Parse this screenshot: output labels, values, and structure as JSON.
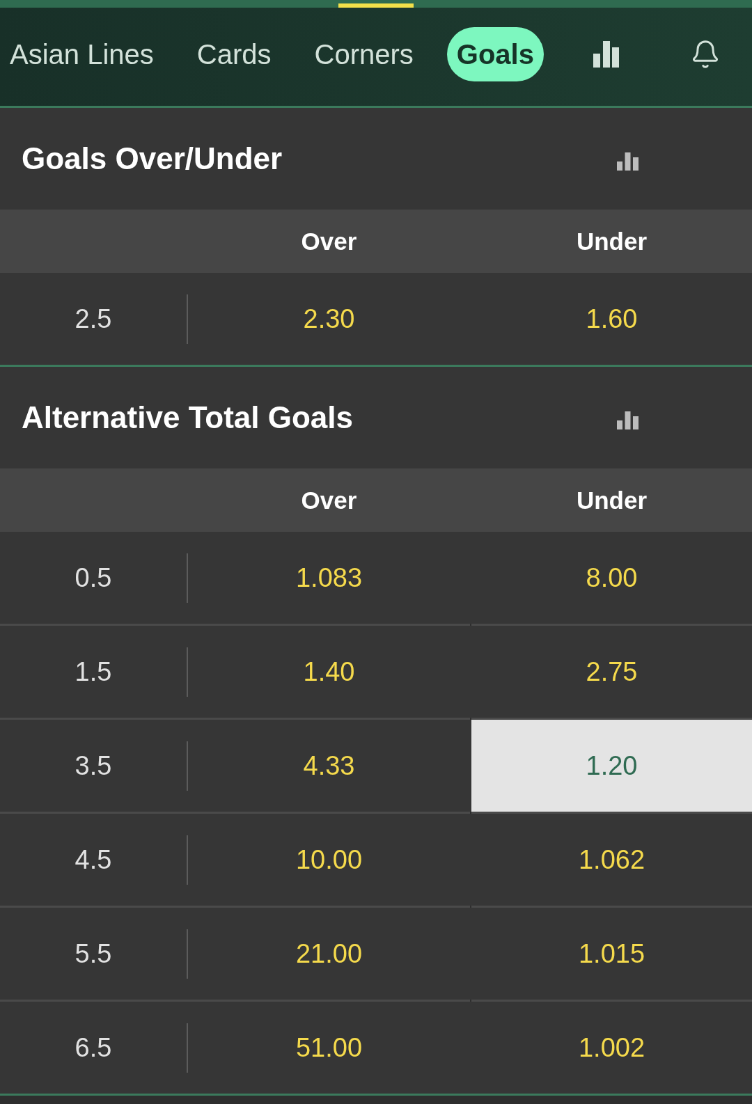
{
  "nav": {
    "tabs": [
      {
        "label": "Asian Lines",
        "selected": false
      },
      {
        "label": "Cards",
        "selected": false
      },
      {
        "label": "Corners",
        "selected": false
      },
      {
        "label": "Goals",
        "selected": true
      }
    ]
  },
  "markets": [
    {
      "title": "Goals Over/Under",
      "columns": [
        "Over",
        "Under"
      ],
      "rows": [
        {
          "line": "2.5",
          "odds": [
            {
              "value": "2.30",
              "selected": false
            },
            {
              "value": "1.60",
              "selected": false
            }
          ]
        }
      ]
    },
    {
      "title": "Alternative Total Goals",
      "columns": [
        "Over",
        "Under"
      ],
      "rows": [
        {
          "line": "0.5",
          "odds": [
            {
              "value": "1.083",
              "selected": false
            },
            {
              "value": "8.00",
              "selected": false
            }
          ]
        },
        {
          "line": "1.5",
          "odds": [
            {
              "value": "1.40",
              "selected": false
            },
            {
              "value": "2.75",
              "selected": false
            }
          ]
        },
        {
          "line": "3.5",
          "odds": [
            {
              "value": "4.33",
              "selected": false
            },
            {
              "value": "1.20",
              "selected": true
            }
          ]
        },
        {
          "line": "4.5",
          "odds": [
            {
              "value": "10.00",
              "selected": false
            },
            {
              "value": "1.062",
              "selected": false
            }
          ]
        },
        {
          "line": "5.5",
          "odds": [
            {
              "value": "21.00",
              "selected": false
            },
            {
              "value": "1.015",
              "selected": false
            }
          ]
        },
        {
          "line": "6.5",
          "odds": [
            {
              "value": "51.00",
              "selected": false
            },
            {
              "value": "1.002",
              "selected": false
            }
          ]
        }
      ]
    }
  ]
}
